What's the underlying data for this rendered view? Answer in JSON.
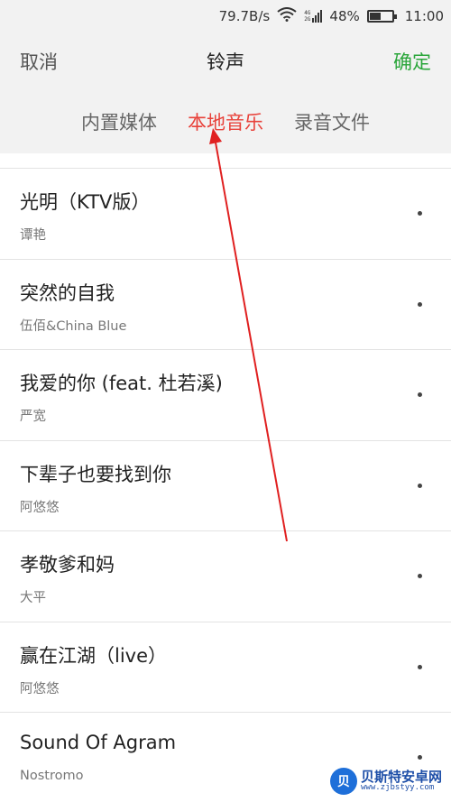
{
  "status": {
    "speed": "79.7B/s",
    "net_top": "4G",
    "net_bottom": "2G",
    "battery_percent": "48%",
    "battery_level": 0.48,
    "time": "11:00",
    "icons": [
      "wifi-icon",
      "signal-icon",
      "battery-icon"
    ]
  },
  "header": {
    "cancel_label": "取消",
    "title": "铃声",
    "confirm_label": "确定"
  },
  "tabs": [
    {
      "label": "内置媒体",
      "active": false
    },
    {
      "label": "本地音乐",
      "active": true
    },
    {
      "label": "录音文件",
      "active": false
    }
  ],
  "songs": [
    {
      "name": "光明（KTV版）",
      "artist": "谭艳"
    },
    {
      "name": "突然的自我",
      "artist": "伍佰&China Blue"
    },
    {
      "name": "我爱的你 (feat. 杜若溪)",
      "artist": "严宽"
    },
    {
      "name": "下辈子也要找到你",
      "artist": "阿悠悠"
    },
    {
      "name": "孝敬爹和妈",
      "artist": "大平"
    },
    {
      "name": "赢在江湖（live）",
      "artist": "阿悠悠"
    },
    {
      "name": "Sound Of Agram",
      "artist": "Nostromo"
    }
  ],
  "watermark": {
    "logo_text": "贝",
    "name": "贝斯特安卓网",
    "url": "www.zjbstyy.com"
  },
  "colors": {
    "accent_red": "#e8413a",
    "confirm_green": "#2aa63a",
    "annotation_arrow": "#e02020"
  }
}
